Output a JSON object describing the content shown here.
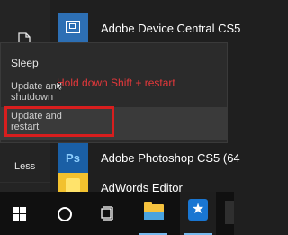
{
  "left_rail": {
    "less_label": "Less"
  },
  "apps": [
    {
      "label": "Adobe Device Central CS5",
      "icon": "device-central-icon"
    },
    {
      "label": "Adobe Photoshop CS5 (64",
      "icon": "photoshop-icon"
    },
    {
      "label": "AdWords Editor",
      "icon": "adwords-editor-icon"
    }
  ],
  "power_menu": {
    "sleep": "Sleep",
    "shutdown": "Update and shutdown",
    "restart": "Update and restart"
  },
  "annotation": {
    "hint": "Hold down Shift + restart",
    "color": "#e5383b",
    "box_color": "#d81e1e"
  },
  "photoshop_tile_text": "Ps",
  "taskbar": {
    "items": [
      "start-icon",
      "search-icon",
      "task-view-icon",
      "file-explorer-icon",
      "pinned-app-icon"
    ],
    "accent": "#76b9ed"
  }
}
